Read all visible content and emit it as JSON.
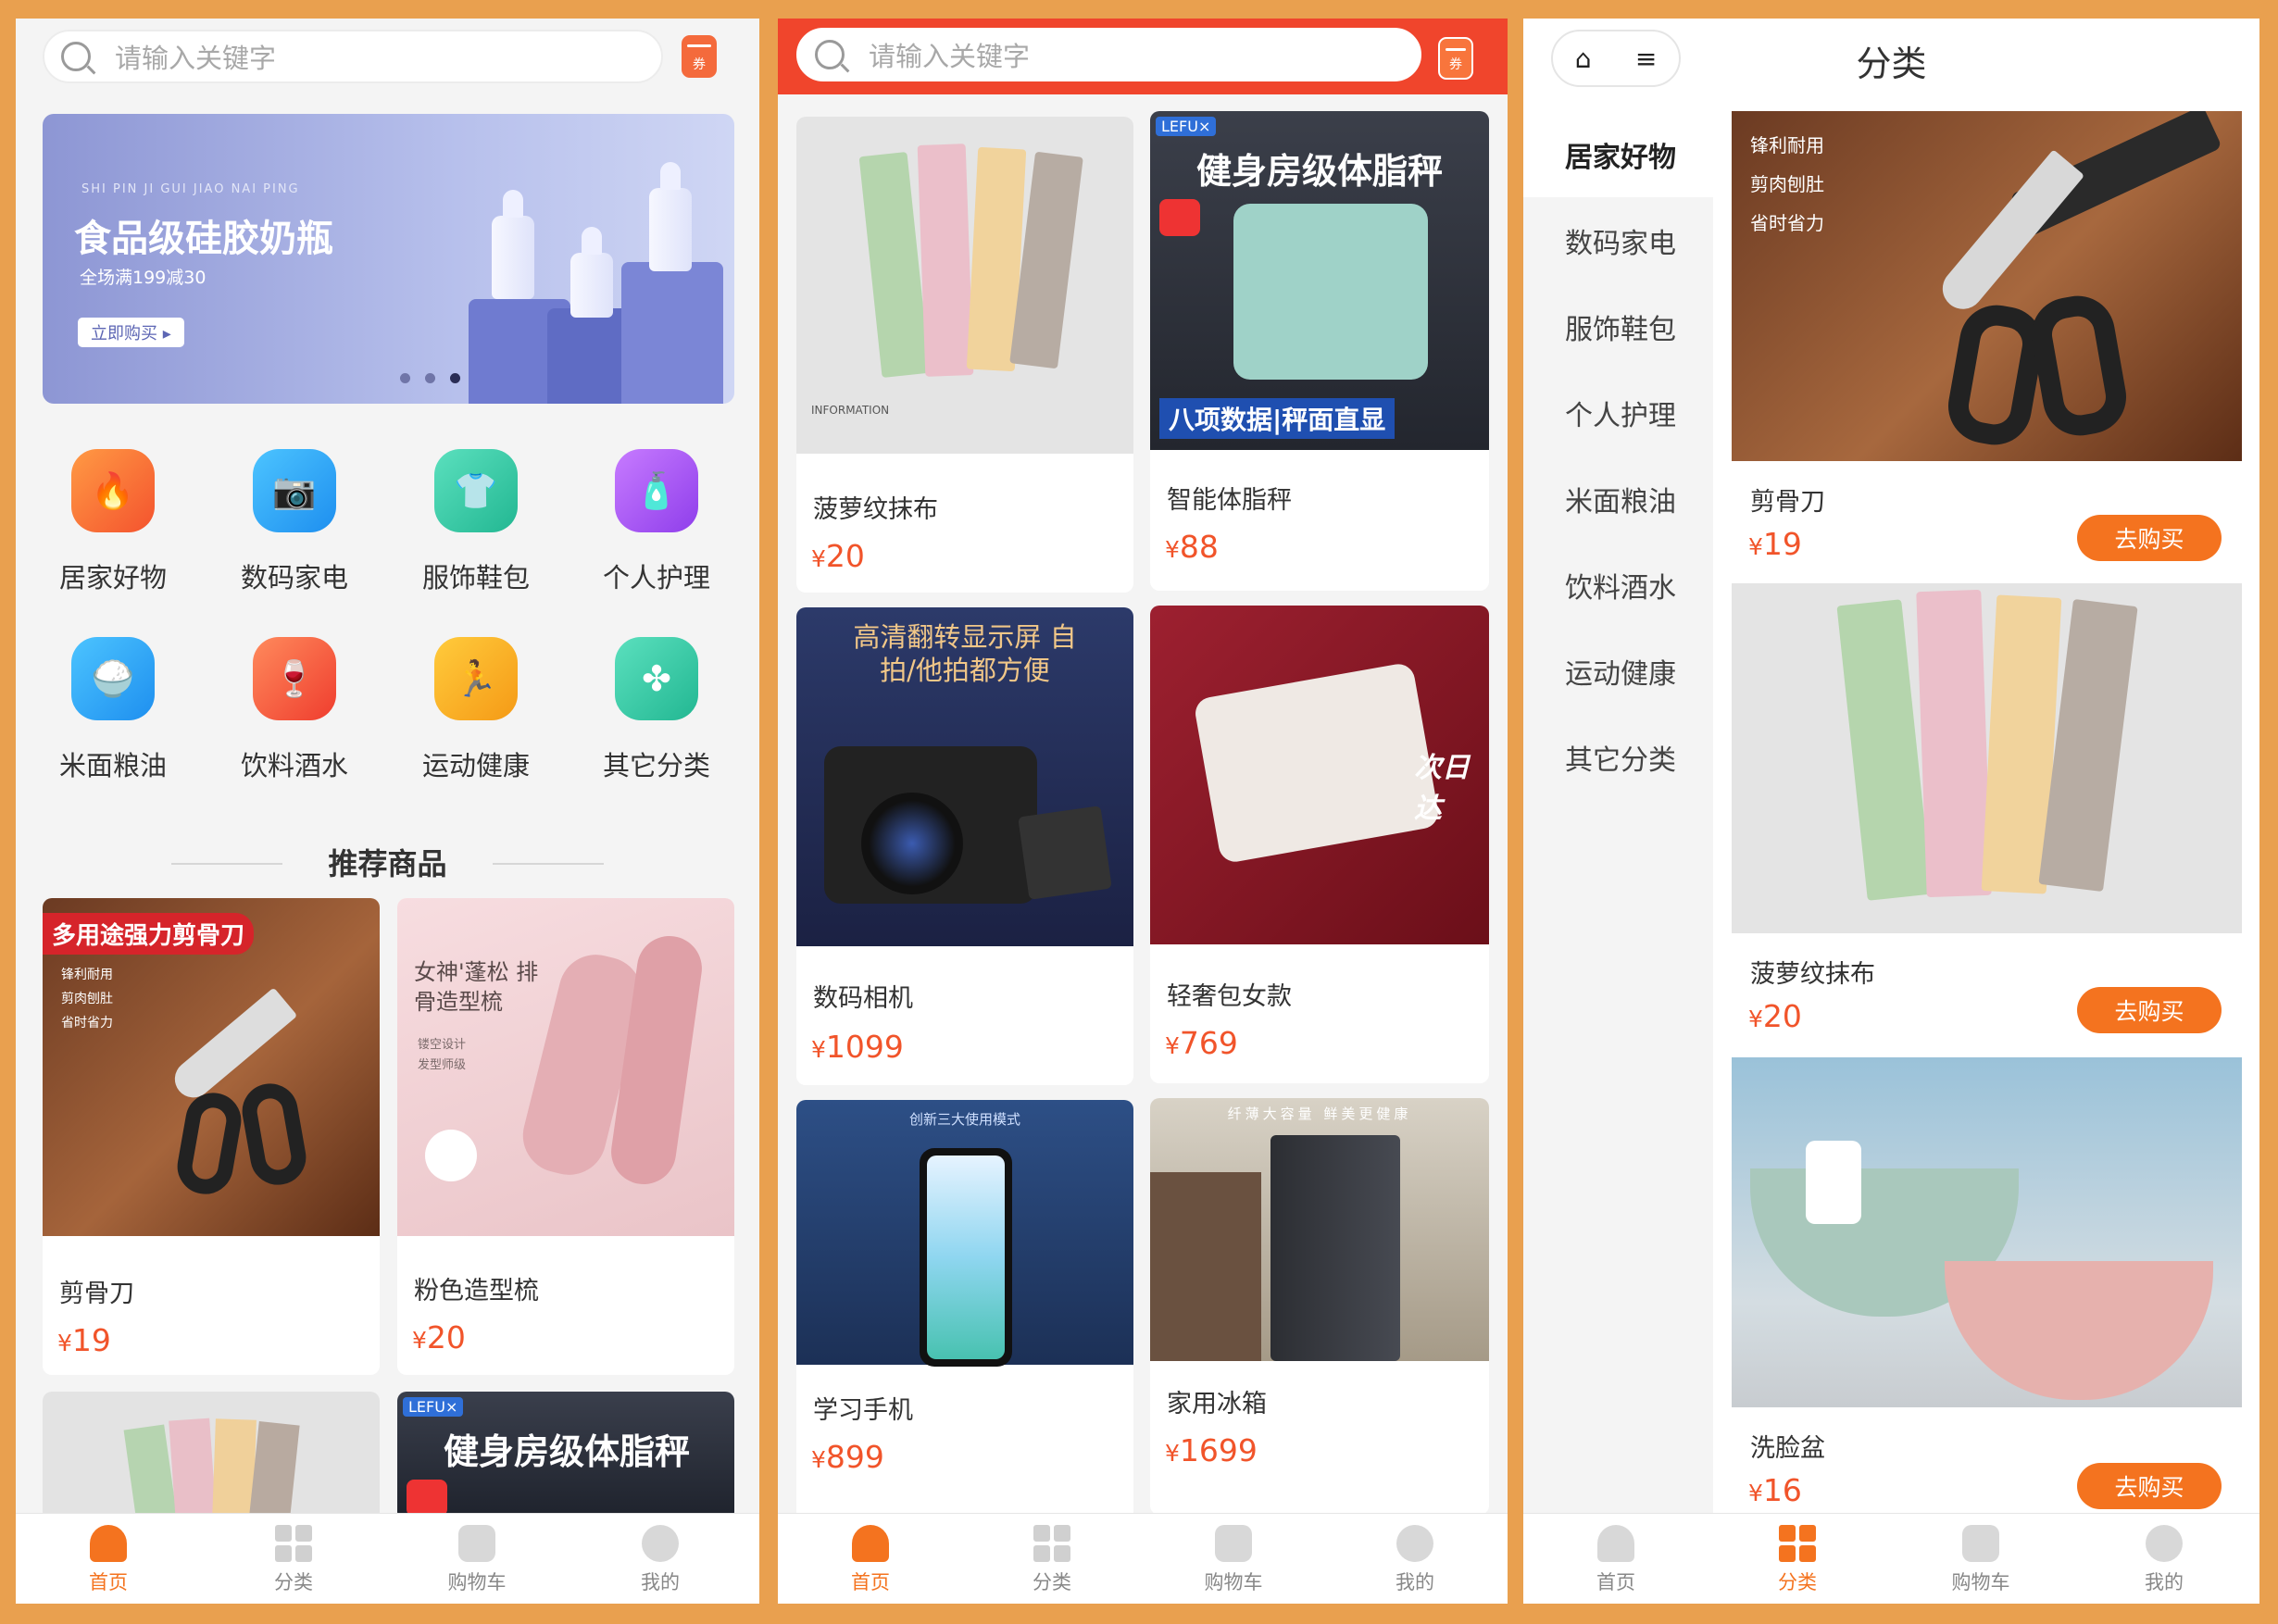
{
  "home": {
    "search_placeholder": "请输入关键字",
    "coupon_label": "券",
    "banner": {
      "pinyin": "SHI PIN JI GUI JIAO NAI PING",
      "title": "食品级硅胶奶瓶",
      "subtitle": "全场满199减30",
      "button": "立即购买 ▸"
    },
    "categories": [
      "居家好物",
      "数码家电",
      "服饰鞋包",
      "个人护理",
      "米面粮油",
      "饮料酒水",
      "运动健康",
      "其它分类"
    ],
    "section_title": "推荐商品",
    "products": [
      {
        "name": "剪骨刀",
        "price": "19",
        "img_title": "多用途强力剪骨刀",
        "img_points": [
          "锋利耐用",
          "剪肉刨肚",
          "省时省力"
        ]
      },
      {
        "name": "粉色造型梳",
        "price": "20",
        "img_title": "女神'蓬松 排骨造型梳",
        "img_points": [
          "镂空设计",
          "发型师级"
        ]
      },
      {
        "name": "菠萝纹抹布",
        "price": "20"
      },
      {
        "name": "智能体脂秤",
        "price": "88",
        "img_brand": "LEFU×",
        "img_title": "健身房级体脂秤"
      }
    ]
  },
  "feed": {
    "search_placeholder": "请输入关键字",
    "coupon_label": "券",
    "products": [
      {
        "name": "菠萝纹抹布",
        "price": "20",
        "img_caption": "INFORMATION"
      },
      {
        "name": "智能体脂秤",
        "price": "88",
        "img_brand": "LEFU×",
        "img_title": "健身房级体脂秤",
        "img_footer": "八项数据|秤面直显"
      },
      {
        "name": "数码相机",
        "price": "1099",
        "img_title": "高清翻转显示屏 自拍/他拍都方便"
      },
      {
        "name": "轻奢包女款",
        "price": "769",
        "img_tag": "次日达"
      },
      {
        "name": "学习手机",
        "price": "899",
        "img_title": "创新三大使用模式"
      },
      {
        "name": "家用冰箱",
        "price": "1699",
        "img_title": "纤薄大容量 鲜美更健康"
      }
    ]
  },
  "category": {
    "title": "分类",
    "sidebar": [
      "居家好物",
      "数码家电",
      "服饰鞋包",
      "个人护理",
      "米面粮油",
      "饮料酒水",
      "运动健康",
      "其它分类"
    ],
    "active": "居家好物",
    "items": [
      {
        "name": "剪骨刀",
        "price": "19",
        "button": "去购买",
        "img_points": [
          "锋利耐用",
          "剪肉刨肚",
          "省时省力"
        ]
      },
      {
        "name": "菠萝纹抹布",
        "price": "20",
        "button": "去购买"
      },
      {
        "name": "洗脸盆",
        "price": "16",
        "button": "去购买"
      }
    ]
  },
  "tabbar": [
    "首页",
    "分类",
    "购物车",
    "我的"
  ],
  "currency": "¥",
  "colors": {
    "accent": "#F4731F",
    "price": "#F1542A",
    "header_red": "#F0452C",
    "frame": "#E9A04F"
  }
}
